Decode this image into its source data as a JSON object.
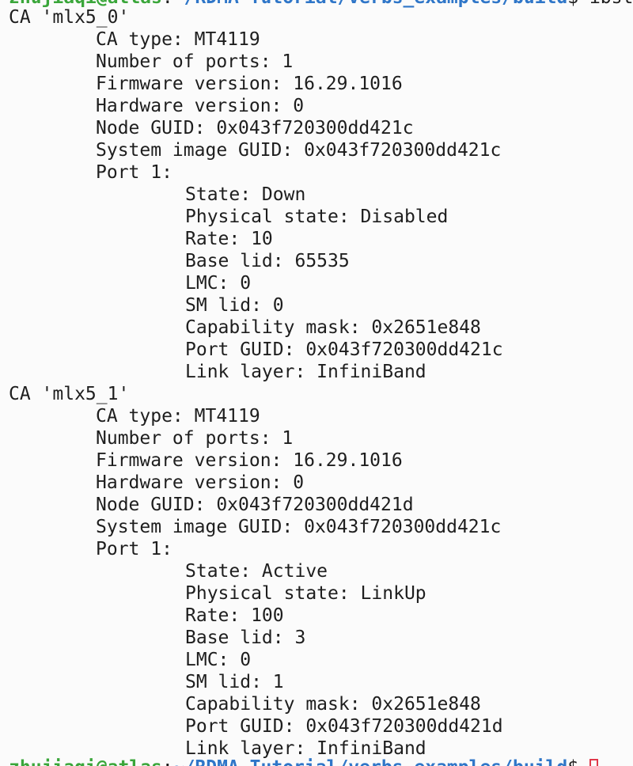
{
  "prompt_top": {
    "user_host": "zhujiaqi@atlas",
    "colon": ":",
    "path": "~/RDMA-Tutorial/verbs_examples/build",
    "symbol": "$",
    "command": " ibstat"
  },
  "devices": [
    {
      "header": "CA 'mlx5_0'",
      "ca_type": "CA type: MT4119",
      "num_ports": "Number of ports: 1",
      "firmware": "Firmware version: 16.29.1016",
      "hardware": "Hardware version: 0",
      "node_guid": "Node GUID: 0x043f720300dd421c",
      "sys_guid": "System image GUID: 0x043f720300dd421c",
      "port_label": "Port 1:",
      "port": {
        "state": "State: Down",
        "physical_state": "Physical state: Disabled",
        "rate": "Rate: 10",
        "base_lid": "Base lid: 65535",
        "lmc": "LMC: 0",
        "sm_lid": "SM lid: 0",
        "cap_mask": "Capability mask: 0x2651e848",
        "port_guid": "Port GUID: 0x043f720300dd421c",
        "link_layer": "Link layer: InfiniBand"
      }
    },
    {
      "header": "CA 'mlx5_1'",
      "ca_type": "CA type: MT4119",
      "num_ports": "Number of ports: 1",
      "firmware": "Firmware version: 16.29.1016",
      "hardware": "Hardware version: 0",
      "node_guid": "Node GUID: 0x043f720300dd421d",
      "sys_guid": "System image GUID: 0x043f720300dd421c",
      "port_label": "Port 1:",
      "port": {
        "state": "State: Active",
        "physical_state": "Physical state: LinkUp",
        "rate": "Rate: 100",
        "base_lid": "Base lid: 3",
        "lmc": "LMC: 0",
        "sm_lid": "SM lid: 1",
        "cap_mask": "Capability mask: 0x2651e848",
        "port_guid": "Port GUID: 0x043f720300dd421d",
        "link_layer": "Link layer: InfiniBand"
      }
    }
  ],
  "prompt_bottom": {
    "user_host": "zhujiaqi@atlas",
    "colon": ":",
    "path": "~/RDMA-Tutorial/verbs_examples/build",
    "symbol": "$",
    "command": " "
  },
  "colors": {
    "background": "#fbfbfb",
    "text": "#1e1e1e",
    "prompt_user": "#3aa63a",
    "prompt_path": "#2f76c8",
    "cursor": "#e0394b"
  }
}
